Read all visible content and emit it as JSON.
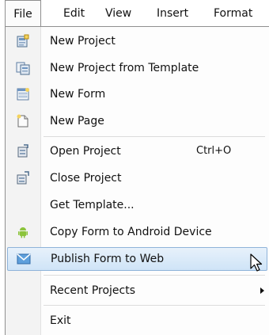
{
  "menubar": {
    "file": "File",
    "edit": "Edit",
    "view": "View",
    "insert": "Insert",
    "format": "Format"
  },
  "menu": {
    "items": [
      {
        "label": "New Project",
        "icon": "new-project-icon"
      },
      {
        "label": "New Project from Template",
        "icon": "template-icon"
      },
      {
        "label": "New Form",
        "icon": "new-form-icon"
      },
      {
        "label": "New Page",
        "icon": "new-page-icon"
      },
      {
        "label": "Open Project",
        "shortcut": "Ctrl+O",
        "icon": "open-project-icon"
      },
      {
        "label": "Close Project",
        "icon": "close-project-icon"
      },
      {
        "label": "Get Template..."
      },
      {
        "label": "Copy Form to Android Device",
        "icon": "android-icon"
      },
      {
        "label": "Publish Form to Web",
        "icon": "publish-web-icon",
        "highlighted": true
      },
      {
        "label": "Recent Projects",
        "submenu": true
      },
      {
        "label": "Exit"
      }
    ]
  },
  "colors": {
    "highlight_top": "#e7f1fb",
    "highlight_bottom": "#cfe4f7",
    "highlight_border": "#8fb3d9",
    "android_green": "#8cc43c"
  }
}
